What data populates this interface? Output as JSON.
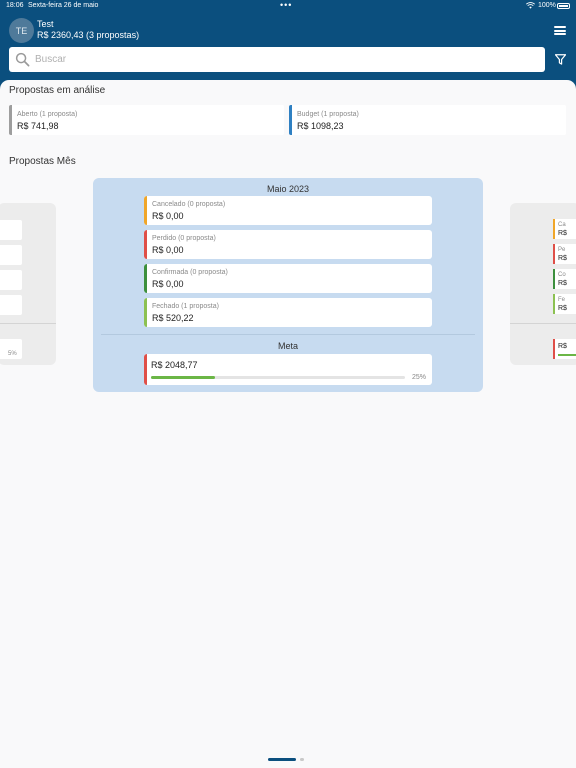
{
  "status": {
    "time": "18:06",
    "date": "Sexta-feira 26 de maio",
    "battery": "100%"
  },
  "user": {
    "initials": "TE",
    "name": "Test",
    "total": "R$ 2360,43 (3 propostas)"
  },
  "search": {
    "placeholder": "Buscar"
  },
  "analysis": {
    "title": "Propostas em análise",
    "cards": [
      {
        "label": "Aberto (1 proposta)",
        "value": "R$ 741,98",
        "color": "#9e9e9e"
      },
      {
        "label": "Budget (1 proposta)",
        "value": "R$ 1098,23",
        "color": "#2f80c2"
      }
    ]
  },
  "month_section": {
    "title": "Propostas Mês"
  },
  "month": {
    "title": "Maio 2023",
    "cards": [
      {
        "label": "Cancelado (0 proposta)",
        "value": "R$ 0,00",
        "color": "#f0a629"
      },
      {
        "label": "Perdido (0 proposta)",
        "value": "R$ 0,00",
        "color": "#df4f48"
      },
      {
        "label": "Confirmada (0 proposta)",
        "value": "R$ 0,00",
        "color": "#3c8f3d"
      },
      {
        "label": "Fechado (1 proposta)",
        "value": "R$ 520,22",
        "color": "#8cc152"
      }
    ],
    "meta": {
      "title": "Meta",
      "value": "R$ 2048,77",
      "progress_percent": 25,
      "progress_label": "25%",
      "color": "#df4f48"
    }
  },
  "left_panel": {
    "progress_label_fragment": "5%"
  },
  "right_panel": {
    "stubs": [
      {
        "label": "Ca",
        "value": "R$",
        "color": "#f0a629"
      },
      {
        "label": "Pe",
        "value": "R$",
        "color": "#df4f48"
      },
      {
        "label": "Co",
        "value": "R$",
        "color": "#3c8f3d"
      },
      {
        "label": "Fe",
        "value": "R$",
        "color": "#8cc152"
      }
    ],
    "meta": {
      "value": "R$",
      "color": "#df4f48"
    }
  }
}
